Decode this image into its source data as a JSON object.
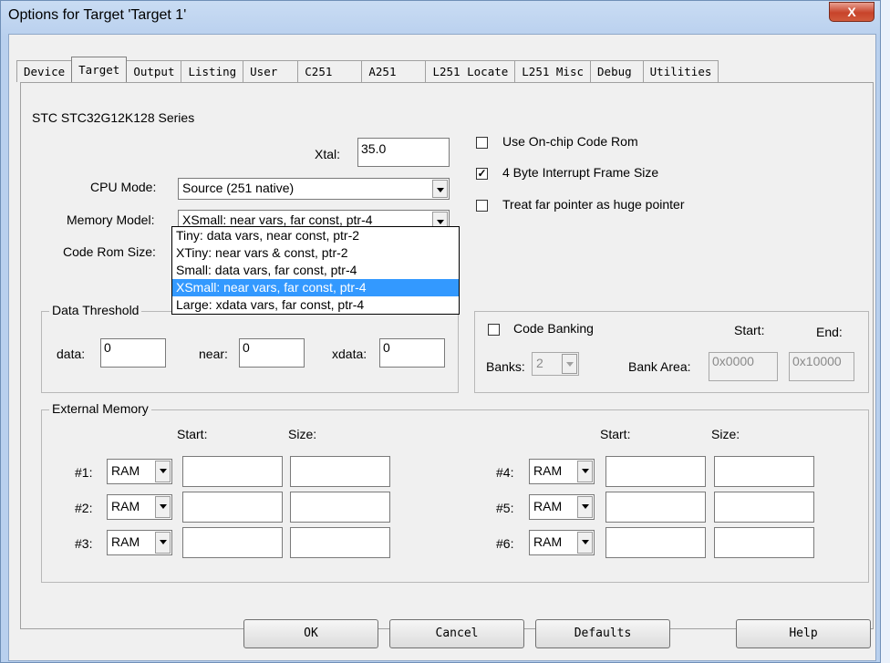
{
  "window": {
    "title": "Options for Target 'Target 1'",
    "close_label": "X"
  },
  "tabs": [
    "Device",
    "Target",
    "Output",
    "Listing",
    "User",
    "C251",
    "A251",
    "L251 Locate",
    "L251 Misc",
    "Debug",
    "Utilities"
  ],
  "active_tab": "Target",
  "target": {
    "series": "STC STC32G12K128 Series",
    "xtal_label": "Xtal:",
    "xtal_value": "35.0",
    "cpu_mode_label": "CPU Mode:",
    "cpu_mode_value": "Source (251 native)",
    "memory_model_label": "Memory Model:",
    "memory_model_value": "XSmall: near vars, far const, ptr-4",
    "code_rom_label": "Code Rom Size:",
    "memory_model_options": [
      "Tiny: data vars, near const, ptr-2",
      "XTiny: near vars & const, ptr-2",
      "Small: data vars, far const, ptr-4",
      "XSmall: near vars, far const, ptr-4",
      "Large: xdata vars, far const, ptr-4"
    ],
    "selected_option_index": 3
  },
  "options": {
    "use_onchip": {
      "label": "Use On-chip Code Rom",
      "checked": false
    },
    "interrupt_frame": {
      "label": "4 Byte Interrupt Frame Size",
      "checked": true
    },
    "far_pointer": {
      "label": "Treat far pointer as huge pointer",
      "checked": false
    }
  },
  "data_threshold": {
    "title": "Data Threshold",
    "data_label": "data:",
    "data_value": "0",
    "near_label": "near:",
    "near_value": "0",
    "xdata_label": "xdata:",
    "xdata_value": "0"
  },
  "code_banking": {
    "label": "Code Banking",
    "checked": false,
    "start_label": "Start:",
    "end_label": "End:",
    "banks_label": "Banks:",
    "banks_value": "2",
    "bank_area_label": "Bank Area:",
    "start_value": "0x0000",
    "end_value": "0x10000"
  },
  "external_memory": {
    "title": "External Memory",
    "start_label": "Start:",
    "size_label": "Size:",
    "rows": [
      {
        "label": "#1:",
        "type": "RAM",
        "start": "",
        "size": ""
      },
      {
        "label": "#2:",
        "type": "RAM",
        "start": "",
        "size": ""
      },
      {
        "label": "#3:",
        "type": "RAM",
        "start": "",
        "size": ""
      },
      {
        "label": "#4:",
        "type": "RAM",
        "start": "",
        "size": ""
      },
      {
        "label": "#5:",
        "type": "RAM",
        "start": "",
        "size": ""
      },
      {
        "label": "#6:",
        "type": "RAM",
        "start": "",
        "size": ""
      }
    ]
  },
  "buttons": {
    "ok": "OK",
    "cancel": "Cancel",
    "defaults": "Defaults",
    "help": "Help"
  }
}
